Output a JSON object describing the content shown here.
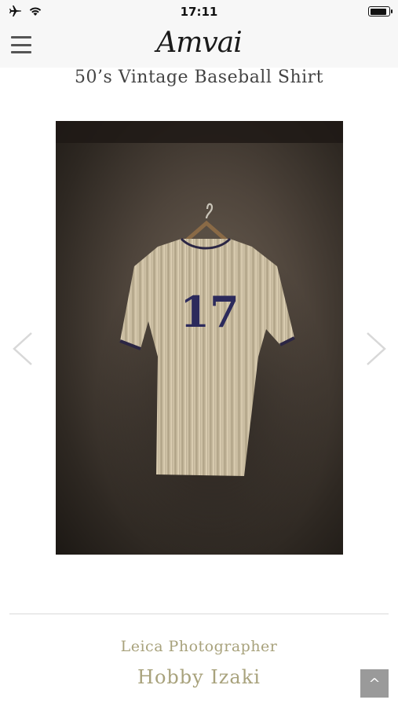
{
  "status_bar": {
    "time": "17:11",
    "icons": [
      "airplane-icon",
      "wifi-icon",
      "battery-icon"
    ]
  },
  "header": {
    "logo_text": "Amvai",
    "menu_icon": "hamburger-menu-icon"
  },
  "article": {
    "title": "50’s Vintage Baseball Shirt"
  },
  "photo": {
    "description_icon": "baseball-shirt-photo",
    "jersey_number": "17"
  },
  "carousel": {
    "prev_icon": "chevron-left-icon",
    "next_icon": "chevron-right-icon"
  },
  "credit": {
    "role": "Leica Photographer",
    "name": "Hobby Izaki"
  },
  "scroll_top": {
    "label": "^"
  },
  "colors": {
    "accent_text": "#a8a27c",
    "header_bg": "#f7f7f7",
    "title_text": "#444444"
  }
}
